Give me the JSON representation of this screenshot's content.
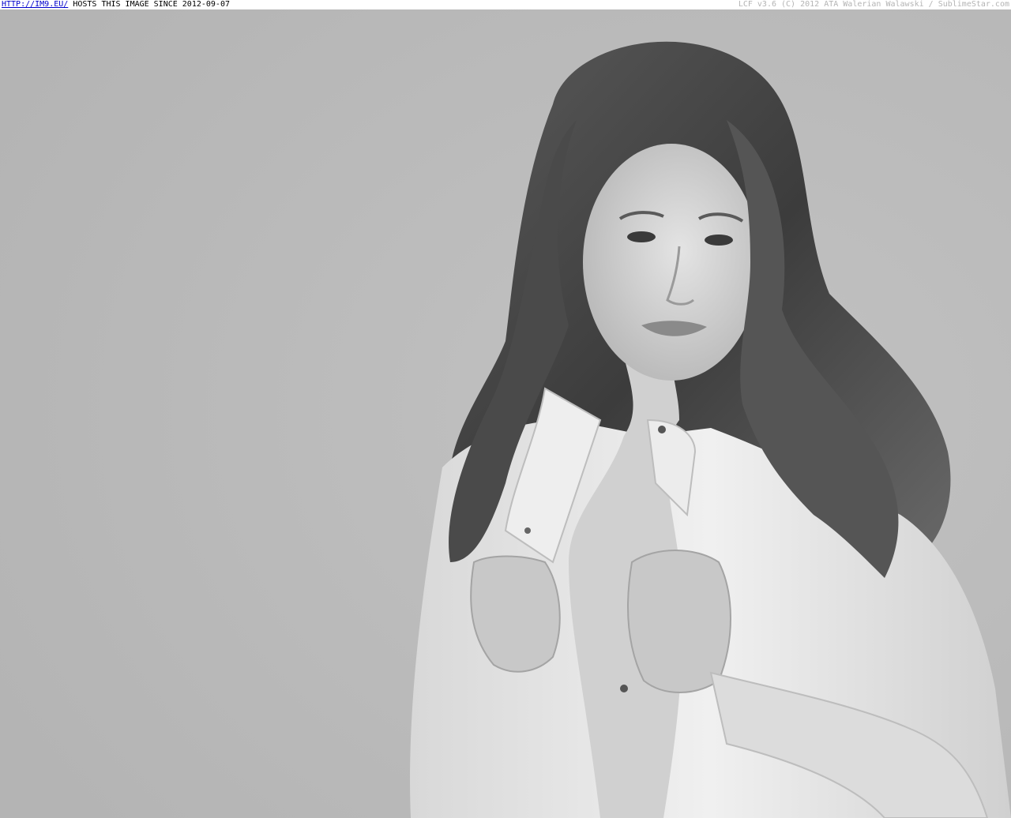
{
  "banner": {
    "host_link": "HTTP://IM9.EU/",
    "host_note": " HOSTS THIS IMAGE SINCE 2012-09-07",
    "copyright": "LCF v3.6 (C) 2012 ATA Walerian Walawski / SublimeStar.com"
  },
  "photo": {
    "style": "black-and-white portrait",
    "colors": {
      "background": "#b9b9b9",
      "shirt": "#e6e6e6",
      "skin": "#d2d2d2",
      "hair": "#4a4a4a"
    }
  }
}
